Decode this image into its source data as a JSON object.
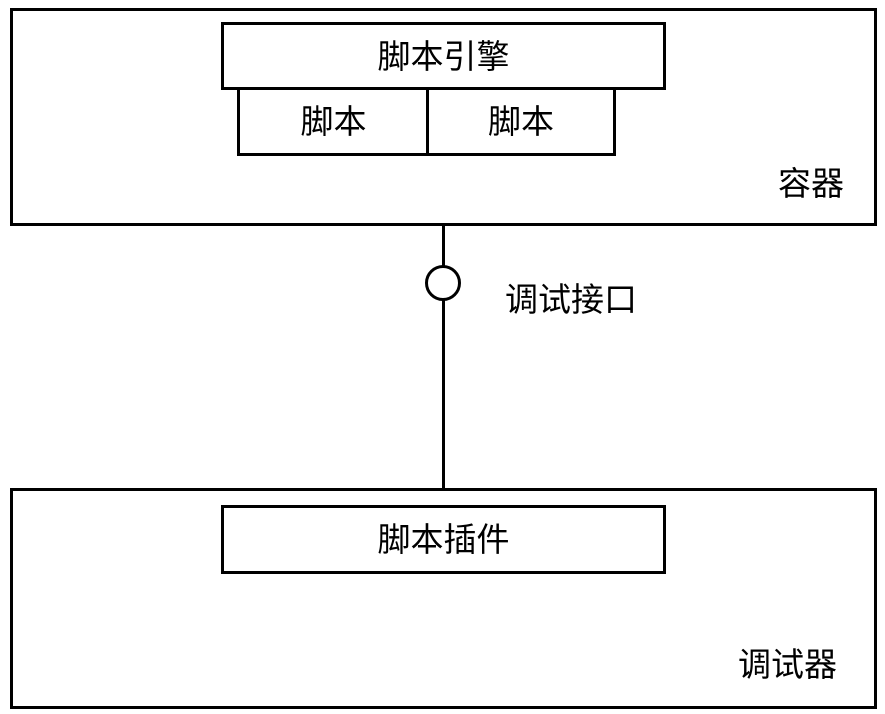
{
  "container": {
    "label": "容器",
    "engine": {
      "label": "脚本引擎"
    },
    "scripts": [
      {
        "label": "脚本"
      },
      {
        "label": "脚本"
      }
    ]
  },
  "interface": {
    "label": "调试接口"
  },
  "debugger": {
    "label": "调试器",
    "plugin": {
      "label": "脚本插件"
    }
  }
}
